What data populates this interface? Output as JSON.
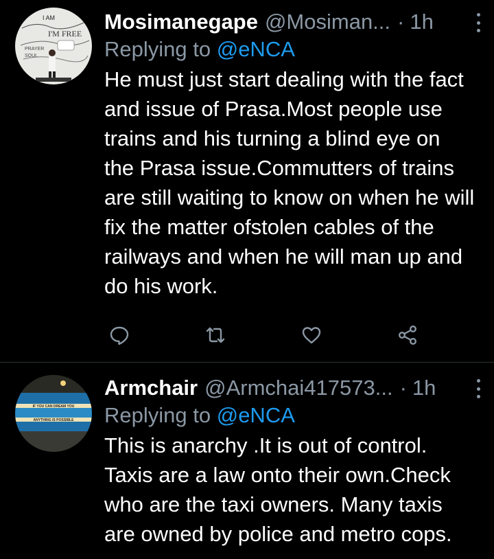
{
  "tweets": [
    {
      "display_name": "Mosimanegape",
      "handle": "@Mosiman...",
      "dot": "·",
      "time": "1h",
      "replying_prefix": "Replying to",
      "replying_to": "@eNCA",
      "text": "He must just start dealing with the fact and issue of Prasa.Most people use trains and his turning a blind eye on the Prasa issue.Commutters of trains are still waiting to know on when he will fix the matter ofstolen cables of the railways and when he will man up and do his work.",
      "avatar_text": [
        "I AM",
        "I'M FREE",
        "PRAYER",
        "SOUL"
      ]
    },
    {
      "display_name": "Armchair",
      "handle": "@Armchai417573...",
      "dot": "·",
      "time": "1h",
      "replying_prefix": "Replying to",
      "replying_to": "@eNCA",
      "text": "This is anarchy .It is out of control. Taxis are a law onto their own.Check who are the taxi owners. Many taxis are owned by police and metro cops.",
      "avatar_text": [
        "IF YOU CAN DREAM YOU",
        "ANYTHING IS POSSIBLE"
      ]
    }
  ],
  "colors": {
    "background": "#000000",
    "text": "#ffffff",
    "muted": "#8b98a5",
    "link": "#1d9bf0",
    "divider": "#2f3336"
  },
  "icons": [
    "reply-icon",
    "retweet-icon",
    "like-icon",
    "share-icon",
    "more-icon"
  ]
}
